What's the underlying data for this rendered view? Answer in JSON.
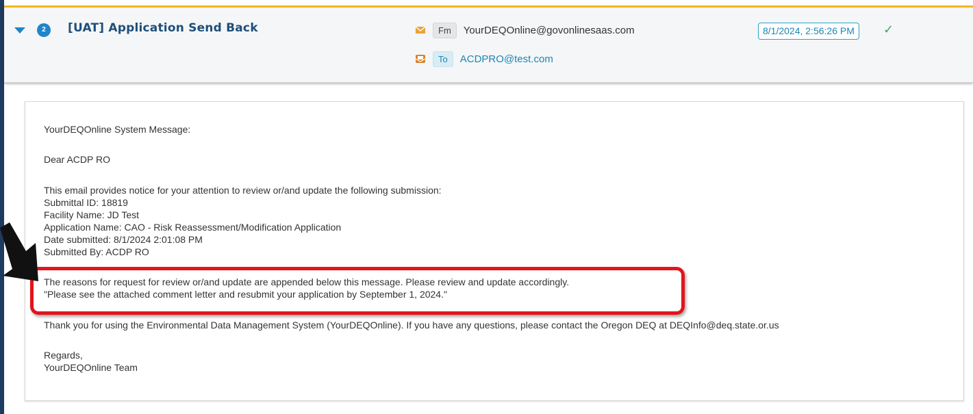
{
  "header": {
    "thread_count": "2",
    "subject": "[UAT] Application Send Back",
    "from_tag": "Fm",
    "from_address": "YourDEQOnline@govonlinesaas.com",
    "to_tag": "To",
    "to_address": "ACDPRO@test.com",
    "timestamp": "8/1/2024, 2:56:26 PM",
    "status_icon": "check-icon",
    "icons": {
      "expand": "caret-down-icon",
      "from": "envelope-icon",
      "to": "envelope-open-icon"
    }
  },
  "message": {
    "lines": [
      "YourDEQOnline System Message:",
      "Dear ACDP RO",
      "This email provides notice for your attention to review or/and update the following submission:",
      "Submittal ID: 18819",
      "Facility Name: JD Test",
      "Application Name: CAO - Risk Reassessment/Modification Application",
      "Date submitted: 8/1/2024 2:01:08 PM",
      "Submitted By: ACDP RO",
      "The reasons for request for review or/and update are appended below this message. Please review and update accordingly.",
      "\"Please see the attached comment letter and resubmit your application by September 1, 2024.\"",
      "Thank you for using the Environmental Data Management System (YourDEQOnline). If you have any questions, please contact the Oregon DEQ at DEQInfo@deq.state.or.us",
      "Regards,",
      "YourDEQOnline Team"
    ]
  },
  "colors": {
    "accent_top": "#f2b422",
    "brand_blue": "#1f4e79",
    "link_teal": "#1a88b4",
    "highlight_red": "#e3141b",
    "check_green": "#3fa66b"
  }
}
